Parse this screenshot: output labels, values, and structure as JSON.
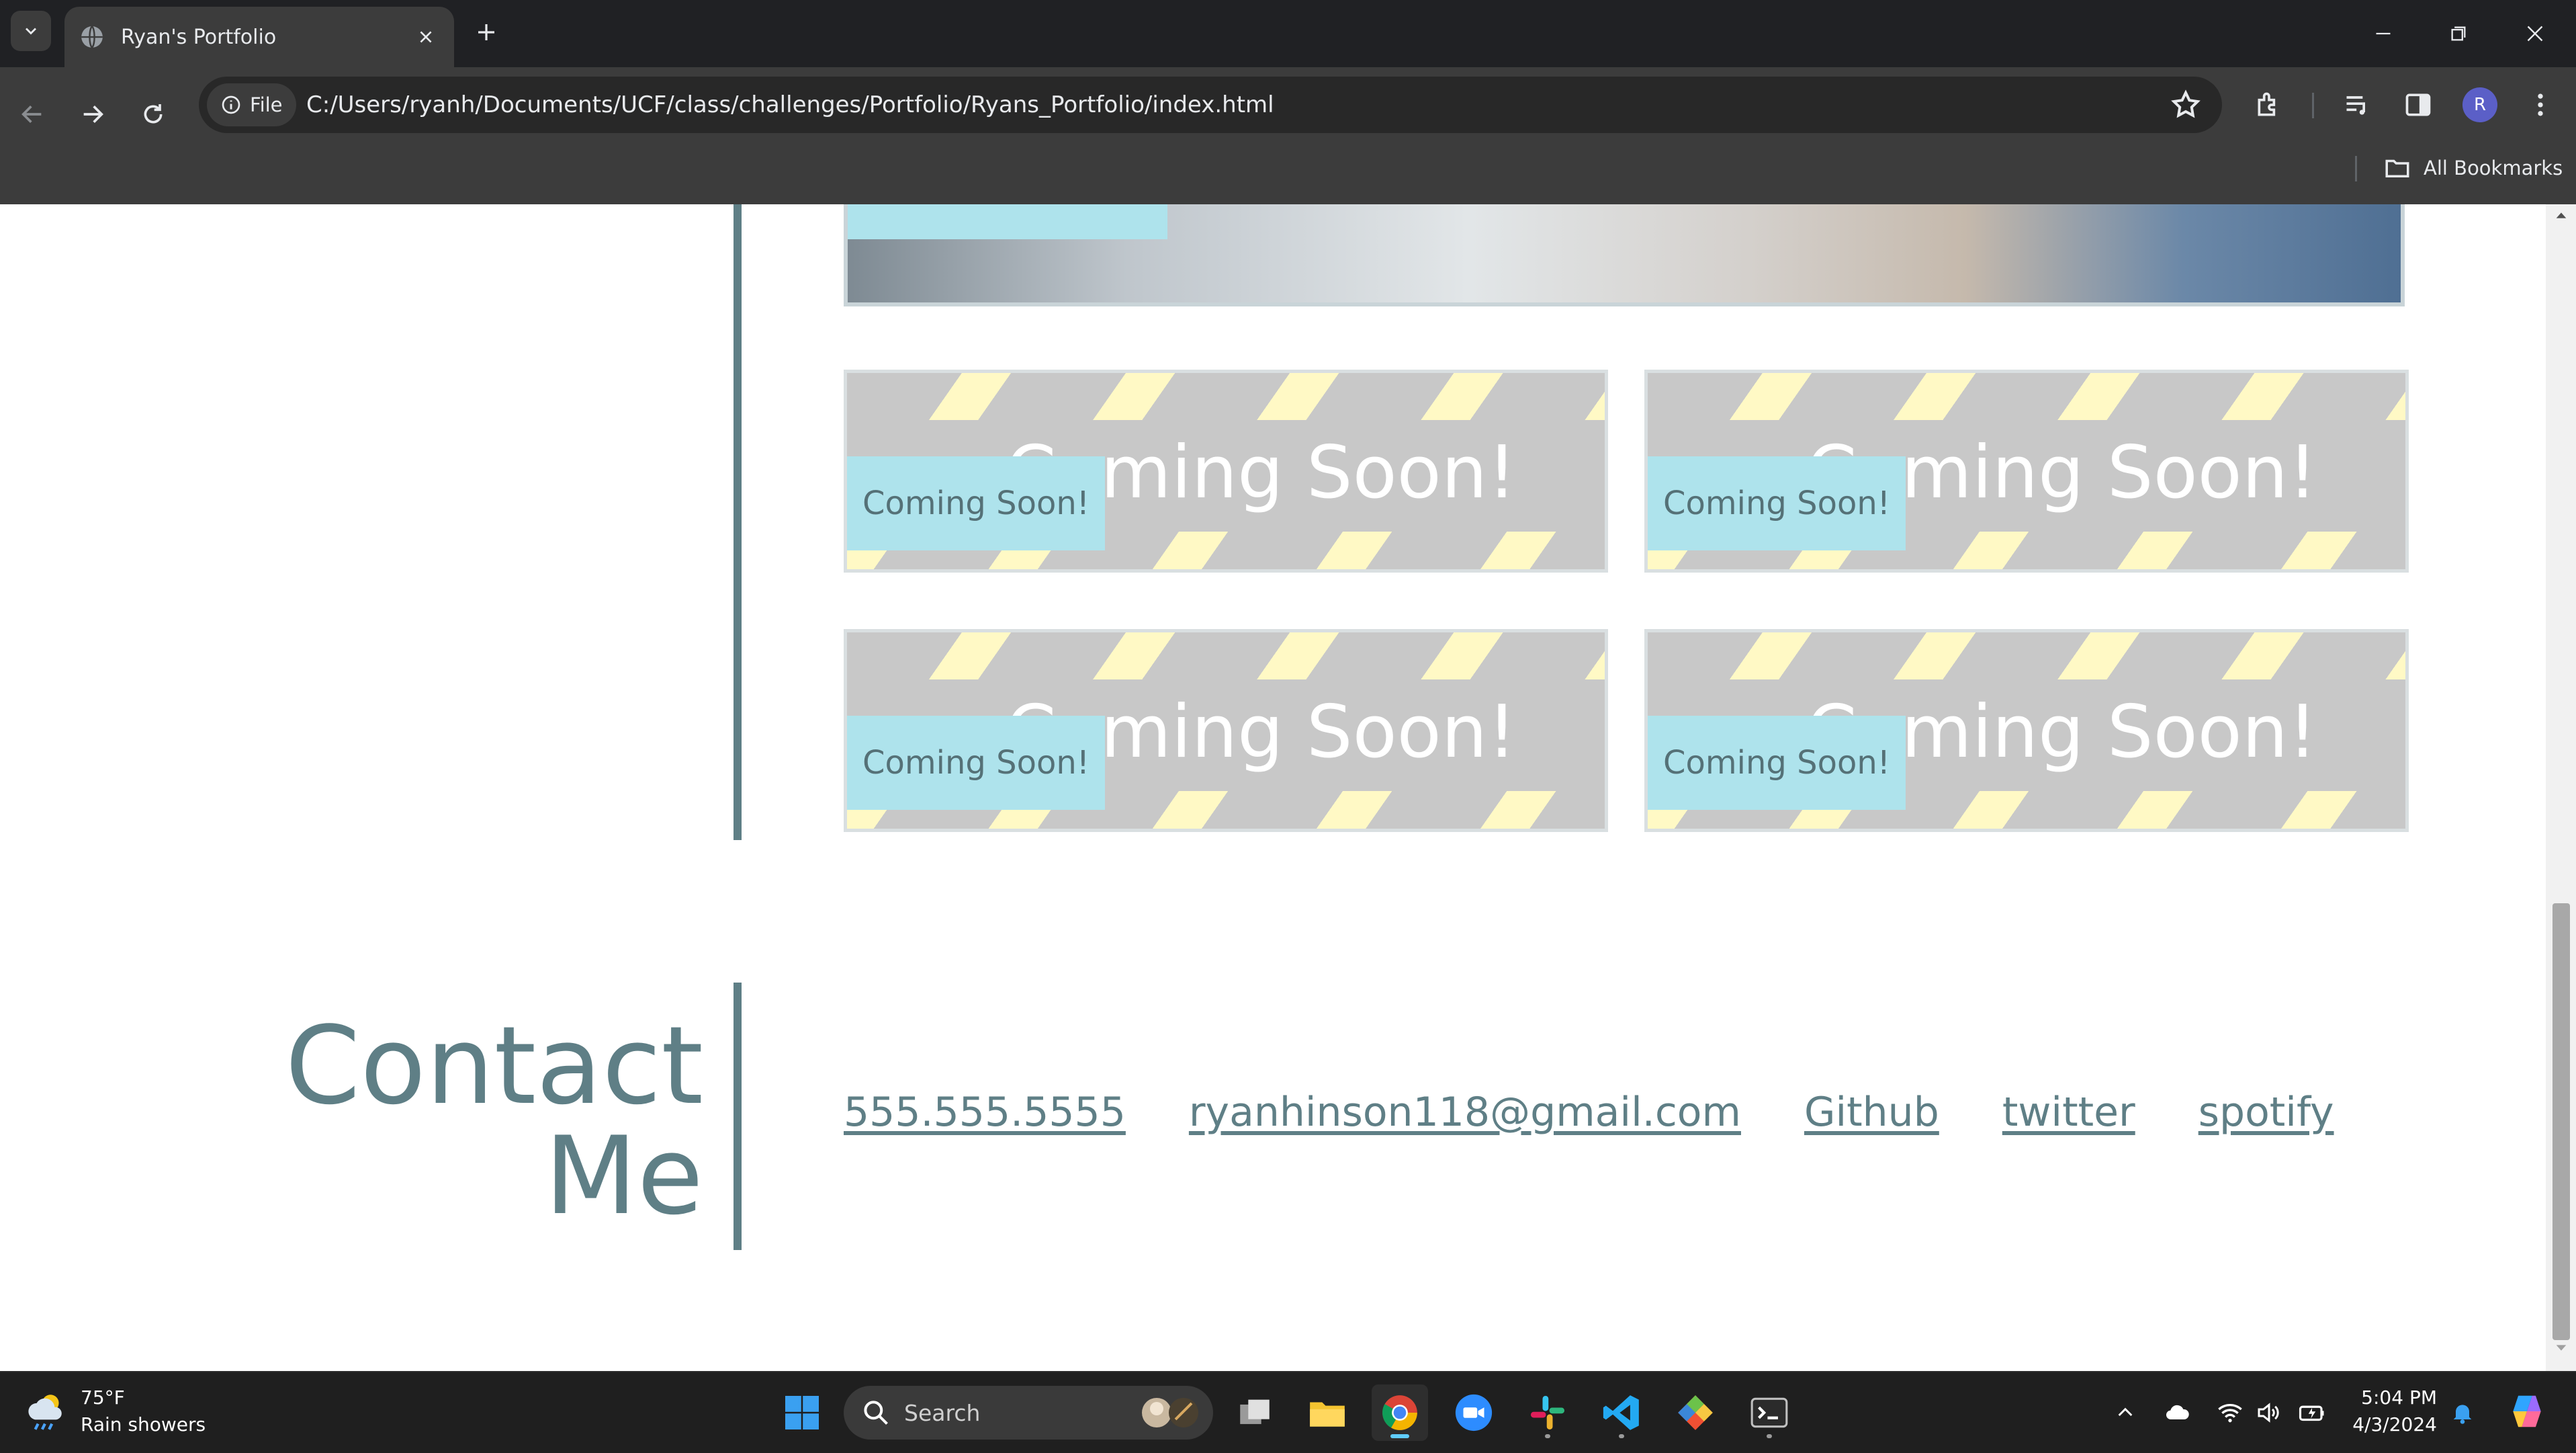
{
  "browser": {
    "tab_title": "Ryan's Portfolio",
    "address_chip": "File",
    "url": "C:/Users/ryanh/Documents/UCF/class/challenges/Portfolio/Ryans_Portfolio/index.html",
    "avatar_initial": "R",
    "bookmarks_label": "All Bookmarks"
  },
  "projects": {
    "cards": [
      {
        "label": "Coming Soon!",
        "banner": "Coming Soon!"
      },
      {
        "label": "Coming Soon!",
        "banner": "Coming Soon!"
      },
      {
        "label": "Coming Soon!",
        "banner": "Coming Soon!"
      },
      {
        "label": "Coming Soon!",
        "banner": "Coming Soon!"
      }
    ]
  },
  "contact": {
    "title_line1": "Contact",
    "title_line2": "Me",
    "links": [
      "555.555.5555",
      "ryanhinson118@gmail.com",
      "Github",
      "twitter",
      "spotify"
    ]
  },
  "taskbar": {
    "weather_temp": "75°F",
    "weather_desc": "Rain showers",
    "search_label": "Search",
    "time": "5:04 PM",
    "date": "4/3/2024"
  },
  "colors": {
    "accent": "#5f7f86",
    "label_bg": "#aee3ec",
    "stripe_yellow": "#fff9c5",
    "card_gray": "#c8c8c8"
  }
}
